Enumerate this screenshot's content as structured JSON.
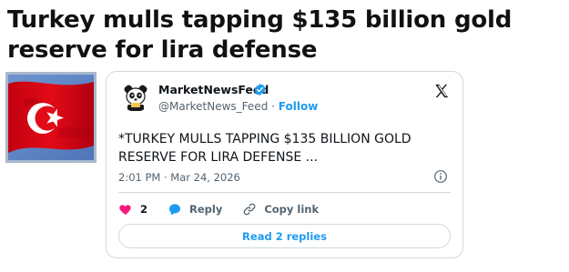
{
  "article": {
    "headline": "Turkey mulls tapping $135 billion gold reserve for lira defense"
  },
  "thumbnail": {
    "icon": "turkish-flag",
    "colors": {
      "flag_red": "#e30a17",
      "sky": "#5f86c4"
    }
  },
  "tweet": {
    "author_name": "MarketNewsFeed",
    "verified": true,
    "handle": "@MarketNews_Feed",
    "separator": "·",
    "follow_label": "Follow",
    "text": "*TURKEY MULLS TAPPING $135 BILLION GOLD RESERVE FOR LIRA DEFENSE ...",
    "timestamp": "2:01 PM · Mar 24, 2026",
    "likes": "2",
    "reply_label": "Reply",
    "copy_link_label": "Copy link",
    "read_replies_label": "Read 2 replies",
    "colors": {
      "accent": "#1d9bf0",
      "like": "#f91880",
      "muted": "#536471",
      "border": "#cfd9de"
    }
  }
}
